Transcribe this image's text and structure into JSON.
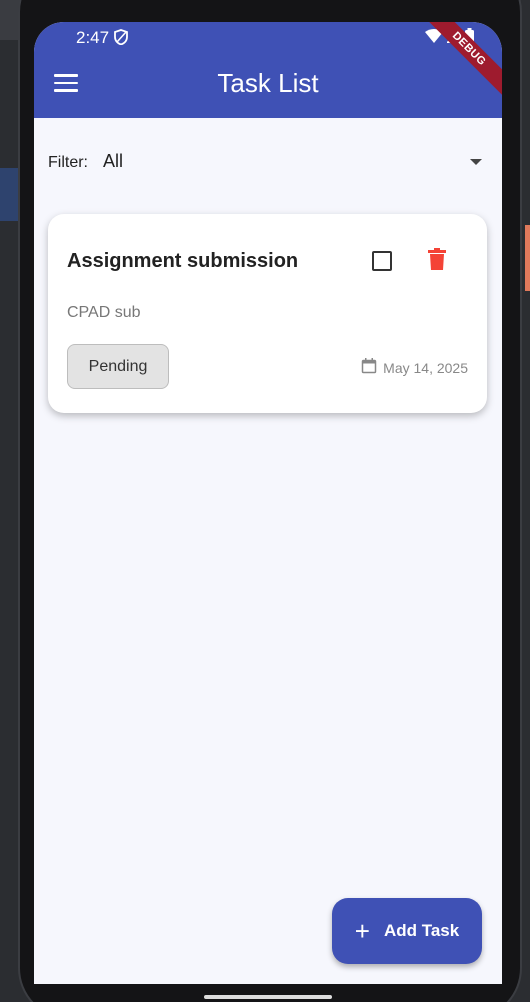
{
  "status_bar": {
    "time": "2:47",
    "debug_label": "DEBUG"
  },
  "app_bar": {
    "title": "Task List",
    "color": "#3f51b5"
  },
  "filter": {
    "label": "Filter:",
    "selected": "All"
  },
  "tasks": [
    {
      "title": "Assignment submission",
      "description": "CPAD sub",
      "status": "Pending",
      "date": "May 14, 2025",
      "completed": false
    }
  ],
  "fab": {
    "label": "Add Task",
    "icon": "plus-icon"
  },
  "colors": {
    "delete": "#f44336",
    "chip_bg": "#e3e3e3"
  }
}
